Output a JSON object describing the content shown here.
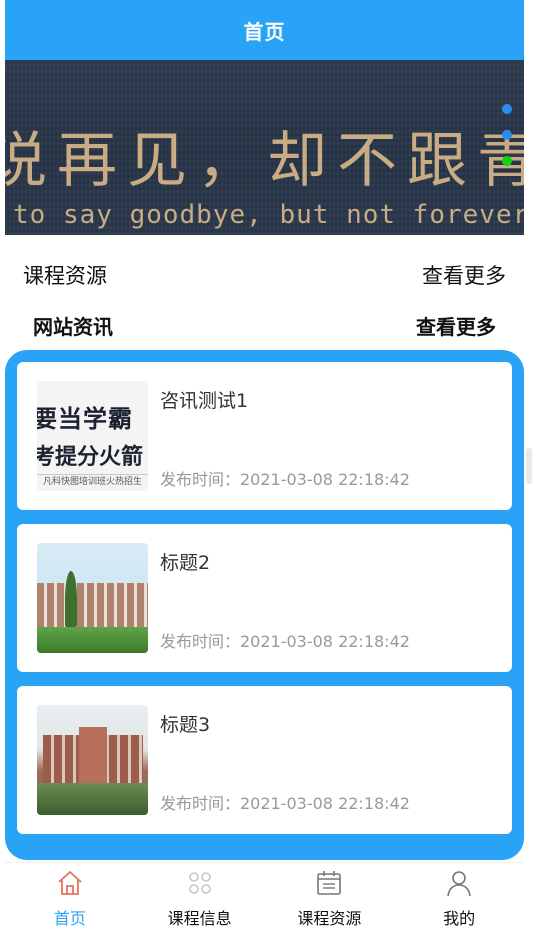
{
  "header": {
    "title": "首页"
  },
  "banner": {
    "line1": "说再见，却不跟青春",
    "line2": "to say goodbye, but not forever",
    "indicator_count": 3,
    "active_indicator": 2
  },
  "sections": {
    "course": {
      "title": "课程资源",
      "more": "查看更多"
    },
    "news": {
      "title": "网站资讯",
      "more": "查看更多"
    }
  },
  "news": [
    {
      "title": "咨讯测试1",
      "meta": "发布时间：2021-03-08 22:18:42",
      "thumb_text_1": "要当学霸",
      "thumb_text_2": "考提分火箭",
      "thumb_caption": "凡科快图培训班火热招生"
    },
    {
      "title": "标题2",
      "meta": "发布时间：2021-03-08 22:18:42"
    },
    {
      "title": "标题3",
      "meta": "发布时间：2021-03-08 22:18:42"
    }
  ],
  "tabs": [
    {
      "label": "首页",
      "icon": "home-icon",
      "active": true
    },
    {
      "label": "课程信息",
      "icon": "grid-icon",
      "active": false
    },
    {
      "label": "课程资源",
      "icon": "calendar-icon",
      "active": false
    },
    {
      "label": "我的",
      "icon": "user-icon",
      "active": false
    }
  ],
  "colors": {
    "primary": "#29a3f6",
    "banner_text": "#c9ab84",
    "active_dot": "#11d111"
  }
}
